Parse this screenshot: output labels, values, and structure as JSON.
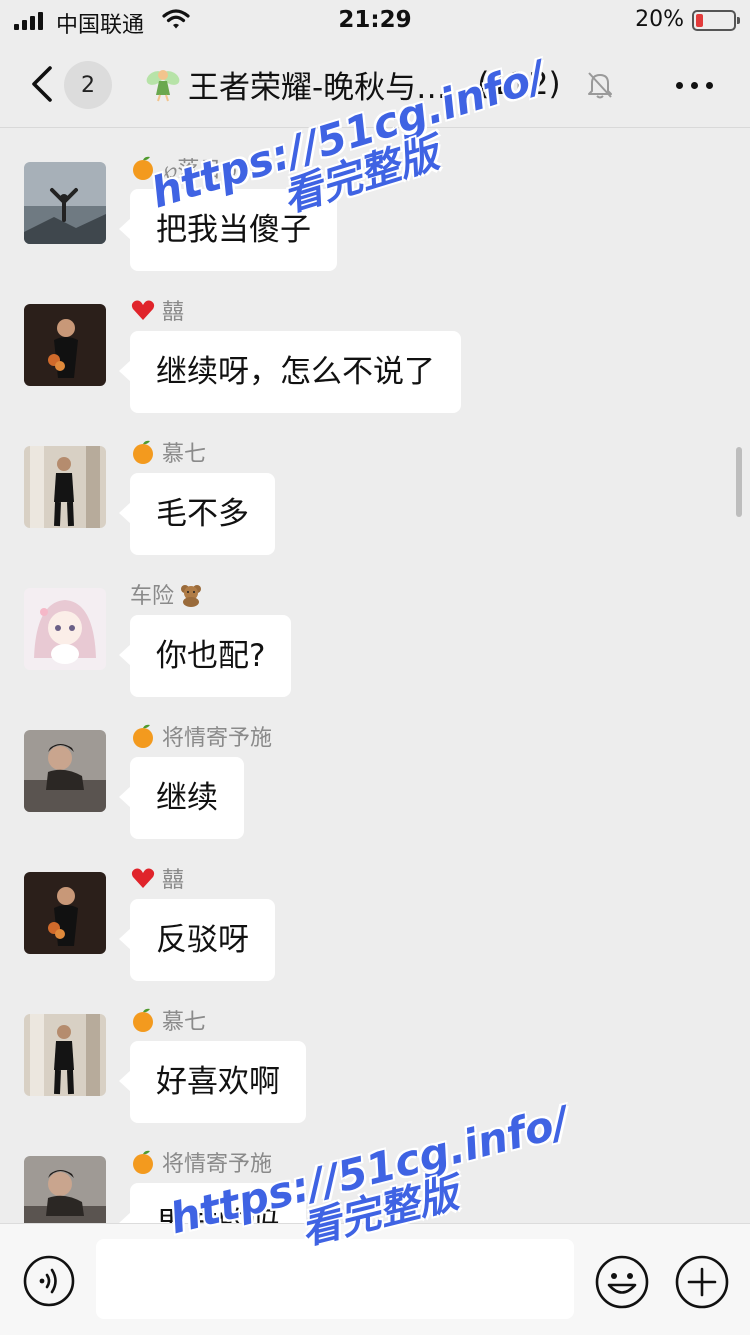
{
  "status_bar": {
    "carrier": "中国联通",
    "time": "21:29",
    "battery": "20%",
    "battery_level": 0.2
  },
  "nav": {
    "back_badge": "2",
    "title": "王者荣耀-晚秋与…",
    "member_count": "(112)"
  },
  "messages": [
    {
      "sender": "℘落日℘",
      "sender_icon": "orange-icon",
      "text": "把我当傻子",
      "avatar": "avatar-mountain"
    },
    {
      "sender": "囍",
      "sender_icon": "heart-icon",
      "text": "继续呀，怎么不说了",
      "avatar": "avatar-woman"
    },
    {
      "sender": "慕七",
      "sender_icon": "orange-icon",
      "text": "毛不多",
      "avatar": "avatar-man-standing"
    },
    {
      "sender": "车险",
      "sender_icon": "teddy-bear-icon",
      "text": "你也配?",
      "avatar": "avatar-anime-girl"
    },
    {
      "sender": "将情寄予施",
      "sender_icon": "orange-icon",
      "text": "继续",
      "avatar": "avatar-man-piano"
    },
    {
      "sender": "囍",
      "sender_icon": "heart-icon",
      "text": "反驳呀",
      "avatar": "avatar-woman"
    },
    {
      "sender": "慕七",
      "sender_icon": "orange-icon",
      "text": "好喜欢啊",
      "avatar": "avatar-man-standing"
    },
    {
      "sender": "将情寄予施",
      "sender_icon": "orange-icon",
      "text": "男方的吗",
      "avatar": "avatar-man-piano"
    }
  ],
  "input_bar": {
    "placeholder": ""
  },
  "watermarks": [
    {
      "url": "https://51cg.info/",
      "sub": "看完整版"
    },
    {
      "url": "https://51cg.info/",
      "sub": "看完整版"
    }
  ],
  "colors": {
    "background": "#ededed",
    "bubble": "#ffffff",
    "watermark": "#3f63e3",
    "battery_low": "#e23b3b"
  }
}
